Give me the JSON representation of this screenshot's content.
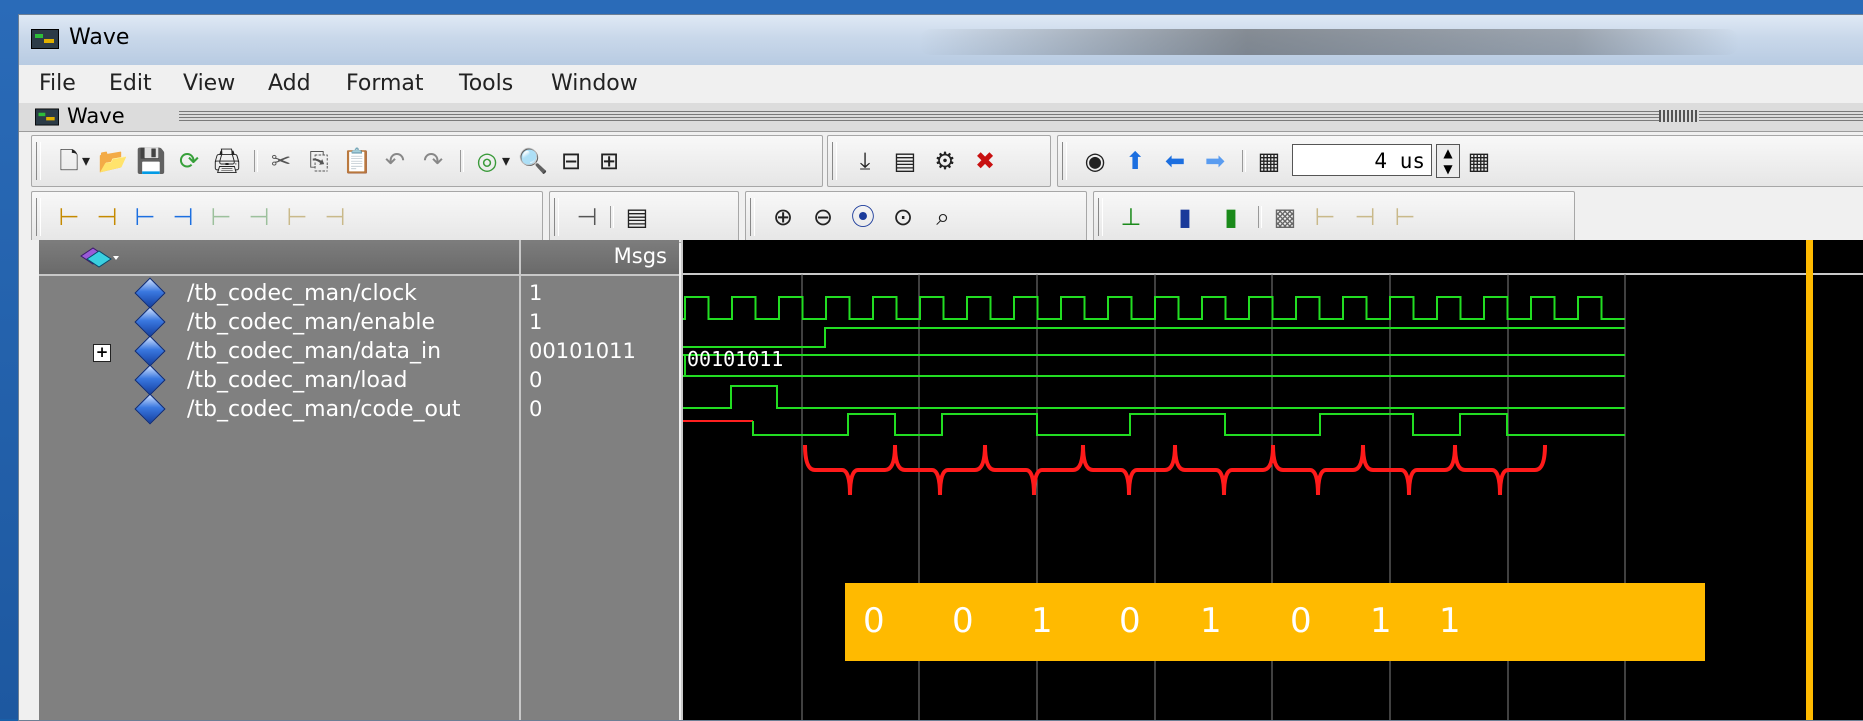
{
  "window": {
    "title": "Wave"
  },
  "menubar": {
    "items": [
      "File",
      "Edit",
      "View",
      "Add",
      "Format",
      "Tools",
      "Window"
    ]
  },
  "wave_pane": {
    "label": "Wave"
  },
  "toolbar": {
    "zoom_value": "4 us",
    "zoom_spin_up": "▲",
    "zoom_spin_down": "▼"
  },
  "icons": {
    "new": "🗋",
    "dropdown": "▾",
    "open": "📂",
    "save": "💾",
    "reload": "⟳",
    "print": "🖨",
    "cut": "✂",
    "copy": "⎘",
    "paste": "📋",
    "undo": "↶",
    "redo": "↷",
    "find_options": "◎",
    "find": "🔍",
    "collapse": "⊟",
    "expand": "⊞",
    "insert": "⤓",
    "config": "▤",
    "run": "⚙",
    "break": "✖",
    "target": "◉",
    "up_arrow": "⬆",
    "left_arrow": "⬅",
    "right_arrow": "➡",
    "page": "▦",
    "zoom_in": "⊕",
    "zoom_out": "⊖",
    "zoom_full": "⦿",
    "zoom_cursor": "⊙",
    "zoom_region": "⌕",
    "sel1": "⊥",
    "sel2": "▮",
    "sel3": "▯",
    "pat": "▩",
    "edge_a": "⊢",
    "edge_b": "⊣"
  },
  "signals_header": {
    "msgs_label": "Msgs"
  },
  "signals": [
    {
      "name": "/tb_codec_man/clock",
      "value": "1",
      "expandable": false
    },
    {
      "name": "/tb_codec_man/enable",
      "value": "1",
      "expandable": false
    },
    {
      "name": "/tb_codec_man/data_in",
      "value": "00101011",
      "expandable": true,
      "expander": "+"
    },
    {
      "name": "/tb_codec_man/load",
      "value": "0",
      "expandable": false
    },
    {
      "name": "/tb_codec_man/code_out",
      "value": "0",
      "expandable": false
    }
  ],
  "waveform": {
    "bus_label": "00101011",
    "trace_color": "#22dd22",
    "undefined_color": "#ff2020",
    "cursor_color": "#ffba00",
    "grid_color": "#808080"
  },
  "annotation": {
    "bits": [
      "0",
      "0",
      "1",
      "0",
      "1",
      "0",
      "1",
      "1"
    ],
    "box_color": "#ffba00",
    "brace_color": "#ff1a1a"
  }
}
